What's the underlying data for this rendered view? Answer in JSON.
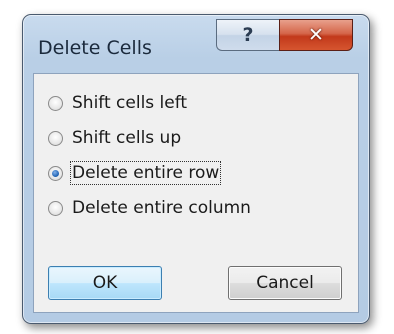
{
  "dialog": {
    "title": "Delete Cells",
    "help_glyph": "?",
    "close_glyph": "✕"
  },
  "options": [
    {
      "label": "Shift cells left",
      "checked": false
    },
    {
      "label": "Shift cells up",
      "checked": false
    },
    {
      "label": "Delete entire row",
      "checked": true
    },
    {
      "label": "Delete entire column",
      "checked": false
    }
  ],
  "buttons": {
    "ok": "OK",
    "cancel": "Cancel"
  }
}
